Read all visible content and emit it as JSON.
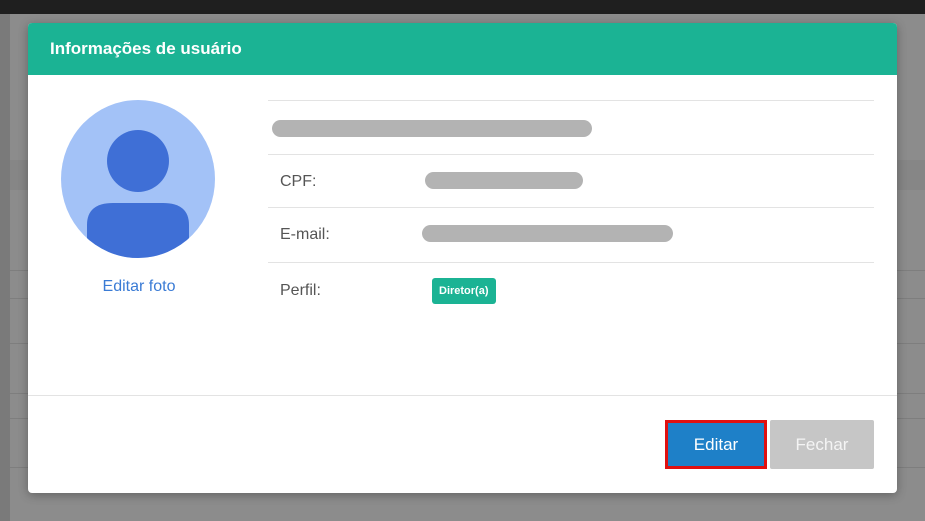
{
  "modal": {
    "title": "Informações de usuário",
    "header_color": "#1bb394",
    "avatar": {
      "icon": "user-icon",
      "background": "#a3c2f7",
      "figure_color": "#3f6fd6"
    },
    "edit_photo_label": "Editar foto",
    "fields": {
      "cpf_label": "CPF:",
      "email_label": "E-mail:",
      "profile_label": "Perfil:",
      "profile_badge": "Diretor(a)"
    },
    "buttons": {
      "edit_label": "Editar",
      "close_label": "Fechar"
    },
    "highlight_color": "#e01010"
  }
}
